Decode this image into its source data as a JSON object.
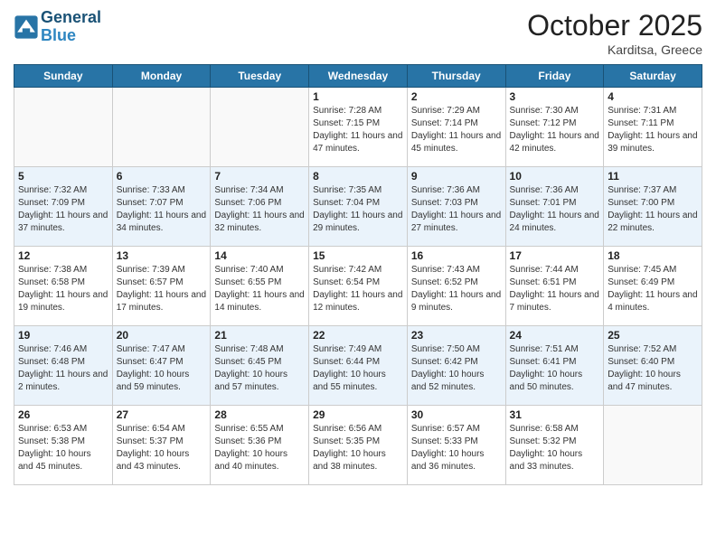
{
  "header": {
    "logo_line1": "General",
    "logo_line2": "Blue",
    "month": "October 2025",
    "location": "Karditsa, Greece"
  },
  "days_of_week": [
    "Sunday",
    "Monday",
    "Tuesday",
    "Wednesday",
    "Thursday",
    "Friday",
    "Saturday"
  ],
  "weeks": [
    [
      {
        "day": "",
        "info": ""
      },
      {
        "day": "",
        "info": ""
      },
      {
        "day": "",
        "info": ""
      },
      {
        "day": "1",
        "info": "Sunrise: 7:28 AM\nSunset: 7:15 PM\nDaylight: 11 hours and 47 minutes."
      },
      {
        "day": "2",
        "info": "Sunrise: 7:29 AM\nSunset: 7:14 PM\nDaylight: 11 hours and 45 minutes."
      },
      {
        "day": "3",
        "info": "Sunrise: 7:30 AM\nSunset: 7:12 PM\nDaylight: 11 hours and 42 minutes."
      },
      {
        "day": "4",
        "info": "Sunrise: 7:31 AM\nSunset: 7:11 PM\nDaylight: 11 hours and 39 minutes."
      }
    ],
    [
      {
        "day": "5",
        "info": "Sunrise: 7:32 AM\nSunset: 7:09 PM\nDaylight: 11 hours and 37 minutes."
      },
      {
        "day": "6",
        "info": "Sunrise: 7:33 AM\nSunset: 7:07 PM\nDaylight: 11 hours and 34 minutes."
      },
      {
        "day": "7",
        "info": "Sunrise: 7:34 AM\nSunset: 7:06 PM\nDaylight: 11 hours and 32 minutes."
      },
      {
        "day": "8",
        "info": "Sunrise: 7:35 AM\nSunset: 7:04 PM\nDaylight: 11 hours and 29 minutes."
      },
      {
        "day": "9",
        "info": "Sunrise: 7:36 AM\nSunset: 7:03 PM\nDaylight: 11 hours and 27 minutes."
      },
      {
        "day": "10",
        "info": "Sunrise: 7:36 AM\nSunset: 7:01 PM\nDaylight: 11 hours and 24 minutes."
      },
      {
        "day": "11",
        "info": "Sunrise: 7:37 AM\nSunset: 7:00 PM\nDaylight: 11 hours and 22 minutes."
      }
    ],
    [
      {
        "day": "12",
        "info": "Sunrise: 7:38 AM\nSunset: 6:58 PM\nDaylight: 11 hours and 19 minutes."
      },
      {
        "day": "13",
        "info": "Sunrise: 7:39 AM\nSunset: 6:57 PM\nDaylight: 11 hours and 17 minutes."
      },
      {
        "day": "14",
        "info": "Sunrise: 7:40 AM\nSunset: 6:55 PM\nDaylight: 11 hours and 14 minutes."
      },
      {
        "day": "15",
        "info": "Sunrise: 7:42 AM\nSunset: 6:54 PM\nDaylight: 11 hours and 12 minutes."
      },
      {
        "day": "16",
        "info": "Sunrise: 7:43 AM\nSunset: 6:52 PM\nDaylight: 11 hours and 9 minutes."
      },
      {
        "day": "17",
        "info": "Sunrise: 7:44 AM\nSunset: 6:51 PM\nDaylight: 11 hours and 7 minutes."
      },
      {
        "day": "18",
        "info": "Sunrise: 7:45 AM\nSunset: 6:49 PM\nDaylight: 11 hours and 4 minutes."
      }
    ],
    [
      {
        "day": "19",
        "info": "Sunrise: 7:46 AM\nSunset: 6:48 PM\nDaylight: 11 hours and 2 minutes."
      },
      {
        "day": "20",
        "info": "Sunrise: 7:47 AM\nSunset: 6:47 PM\nDaylight: 10 hours and 59 minutes."
      },
      {
        "day": "21",
        "info": "Sunrise: 7:48 AM\nSunset: 6:45 PM\nDaylight: 10 hours and 57 minutes."
      },
      {
        "day": "22",
        "info": "Sunrise: 7:49 AM\nSunset: 6:44 PM\nDaylight: 10 hours and 55 minutes."
      },
      {
        "day": "23",
        "info": "Sunrise: 7:50 AM\nSunset: 6:42 PM\nDaylight: 10 hours and 52 minutes."
      },
      {
        "day": "24",
        "info": "Sunrise: 7:51 AM\nSunset: 6:41 PM\nDaylight: 10 hours and 50 minutes."
      },
      {
        "day": "25",
        "info": "Sunrise: 7:52 AM\nSunset: 6:40 PM\nDaylight: 10 hours and 47 minutes."
      }
    ],
    [
      {
        "day": "26",
        "info": "Sunrise: 6:53 AM\nSunset: 5:38 PM\nDaylight: 10 hours and 45 minutes."
      },
      {
        "day": "27",
        "info": "Sunrise: 6:54 AM\nSunset: 5:37 PM\nDaylight: 10 hours and 43 minutes."
      },
      {
        "day": "28",
        "info": "Sunrise: 6:55 AM\nSunset: 5:36 PM\nDaylight: 10 hours and 40 minutes."
      },
      {
        "day": "29",
        "info": "Sunrise: 6:56 AM\nSunset: 5:35 PM\nDaylight: 10 hours and 38 minutes."
      },
      {
        "day": "30",
        "info": "Sunrise: 6:57 AM\nSunset: 5:33 PM\nDaylight: 10 hours and 36 minutes."
      },
      {
        "day": "31",
        "info": "Sunrise: 6:58 AM\nSunset: 5:32 PM\nDaylight: 10 hours and 33 minutes."
      },
      {
        "day": "",
        "info": ""
      }
    ]
  ]
}
